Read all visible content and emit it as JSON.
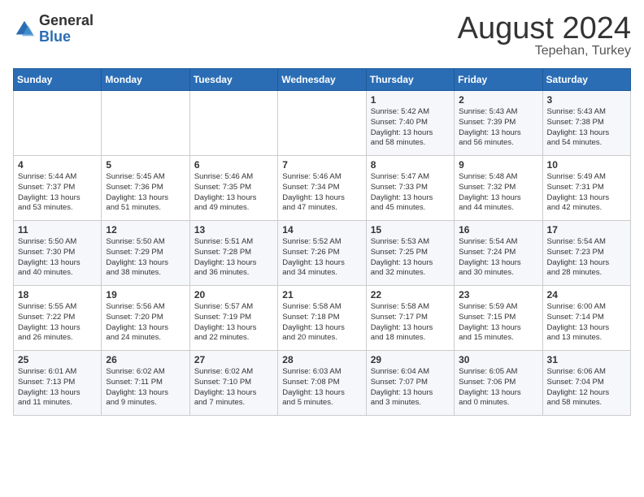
{
  "logo": {
    "general": "General",
    "blue": "Blue"
  },
  "header": {
    "month": "August 2024",
    "location": "Tepehan, Turkey"
  },
  "days_of_week": [
    "Sunday",
    "Monday",
    "Tuesday",
    "Wednesday",
    "Thursday",
    "Friday",
    "Saturday"
  ],
  "weeks": [
    [
      {
        "day": "",
        "info": ""
      },
      {
        "day": "",
        "info": ""
      },
      {
        "day": "",
        "info": ""
      },
      {
        "day": "",
        "info": ""
      },
      {
        "day": "1",
        "info": "Sunrise: 5:42 AM\nSunset: 7:40 PM\nDaylight: 13 hours\nand 58 minutes."
      },
      {
        "day": "2",
        "info": "Sunrise: 5:43 AM\nSunset: 7:39 PM\nDaylight: 13 hours\nand 56 minutes."
      },
      {
        "day": "3",
        "info": "Sunrise: 5:43 AM\nSunset: 7:38 PM\nDaylight: 13 hours\nand 54 minutes."
      }
    ],
    [
      {
        "day": "4",
        "info": "Sunrise: 5:44 AM\nSunset: 7:37 PM\nDaylight: 13 hours\nand 53 minutes."
      },
      {
        "day": "5",
        "info": "Sunrise: 5:45 AM\nSunset: 7:36 PM\nDaylight: 13 hours\nand 51 minutes."
      },
      {
        "day": "6",
        "info": "Sunrise: 5:46 AM\nSunset: 7:35 PM\nDaylight: 13 hours\nand 49 minutes."
      },
      {
        "day": "7",
        "info": "Sunrise: 5:46 AM\nSunset: 7:34 PM\nDaylight: 13 hours\nand 47 minutes."
      },
      {
        "day": "8",
        "info": "Sunrise: 5:47 AM\nSunset: 7:33 PM\nDaylight: 13 hours\nand 45 minutes."
      },
      {
        "day": "9",
        "info": "Sunrise: 5:48 AM\nSunset: 7:32 PM\nDaylight: 13 hours\nand 44 minutes."
      },
      {
        "day": "10",
        "info": "Sunrise: 5:49 AM\nSunset: 7:31 PM\nDaylight: 13 hours\nand 42 minutes."
      }
    ],
    [
      {
        "day": "11",
        "info": "Sunrise: 5:50 AM\nSunset: 7:30 PM\nDaylight: 13 hours\nand 40 minutes."
      },
      {
        "day": "12",
        "info": "Sunrise: 5:50 AM\nSunset: 7:29 PM\nDaylight: 13 hours\nand 38 minutes."
      },
      {
        "day": "13",
        "info": "Sunrise: 5:51 AM\nSunset: 7:28 PM\nDaylight: 13 hours\nand 36 minutes."
      },
      {
        "day": "14",
        "info": "Sunrise: 5:52 AM\nSunset: 7:26 PM\nDaylight: 13 hours\nand 34 minutes."
      },
      {
        "day": "15",
        "info": "Sunrise: 5:53 AM\nSunset: 7:25 PM\nDaylight: 13 hours\nand 32 minutes."
      },
      {
        "day": "16",
        "info": "Sunrise: 5:54 AM\nSunset: 7:24 PM\nDaylight: 13 hours\nand 30 minutes."
      },
      {
        "day": "17",
        "info": "Sunrise: 5:54 AM\nSunset: 7:23 PM\nDaylight: 13 hours\nand 28 minutes."
      }
    ],
    [
      {
        "day": "18",
        "info": "Sunrise: 5:55 AM\nSunset: 7:22 PM\nDaylight: 13 hours\nand 26 minutes."
      },
      {
        "day": "19",
        "info": "Sunrise: 5:56 AM\nSunset: 7:20 PM\nDaylight: 13 hours\nand 24 minutes."
      },
      {
        "day": "20",
        "info": "Sunrise: 5:57 AM\nSunset: 7:19 PM\nDaylight: 13 hours\nand 22 minutes."
      },
      {
        "day": "21",
        "info": "Sunrise: 5:58 AM\nSunset: 7:18 PM\nDaylight: 13 hours\nand 20 minutes."
      },
      {
        "day": "22",
        "info": "Sunrise: 5:58 AM\nSunset: 7:17 PM\nDaylight: 13 hours\nand 18 minutes."
      },
      {
        "day": "23",
        "info": "Sunrise: 5:59 AM\nSunset: 7:15 PM\nDaylight: 13 hours\nand 15 minutes."
      },
      {
        "day": "24",
        "info": "Sunrise: 6:00 AM\nSunset: 7:14 PM\nDaylight: 13 hours\nand 13 minutes."
      }
    ],
    [
      {
        "day": "25",
        "info": "Sunrise: 6:01 AM\nSunset: 7:13 PM\nDaylight: 13 hours\nand 11 minutes."
      },
      {
        "day": "26",
        "info": "Sunrise: 6:02 AM\nSunset: 7:11 PM\nDaylight: 13 hours\nand 9 minutes."
      },
      {
        "day": "27",
        "info": "Sunrise: 6:02 AM\nSunset: 7:10 PM\nDaylight: 13 hours\nand 7 minutes."
      },
      {
        "day": "28",
        "info": "Sunrise: 6:03 AM\nSunset: 7:08 PM\nDaylight: 13 hours\nand 5 minutes."
      },
      {
        "day": "29",
        "info": "Sunrise: 6:04 AM\nSunset: 7:07 PM\nDaylight: 13 hours\nand 3 minutes."
      },
      {
        "day": "30",
        "info": "Sunrise: 6:05 AM\nSunset: 7:06 PM\nDaylight: 13 hours\nand 0 minutes."
      },
      {
        "day": "31",
        "info": "Sunrise: 6:06 AM\nSunset: 7:04 PM\nDaylight: 12 hours\nand 58 minutes."
      }
    ]
  ]
}
